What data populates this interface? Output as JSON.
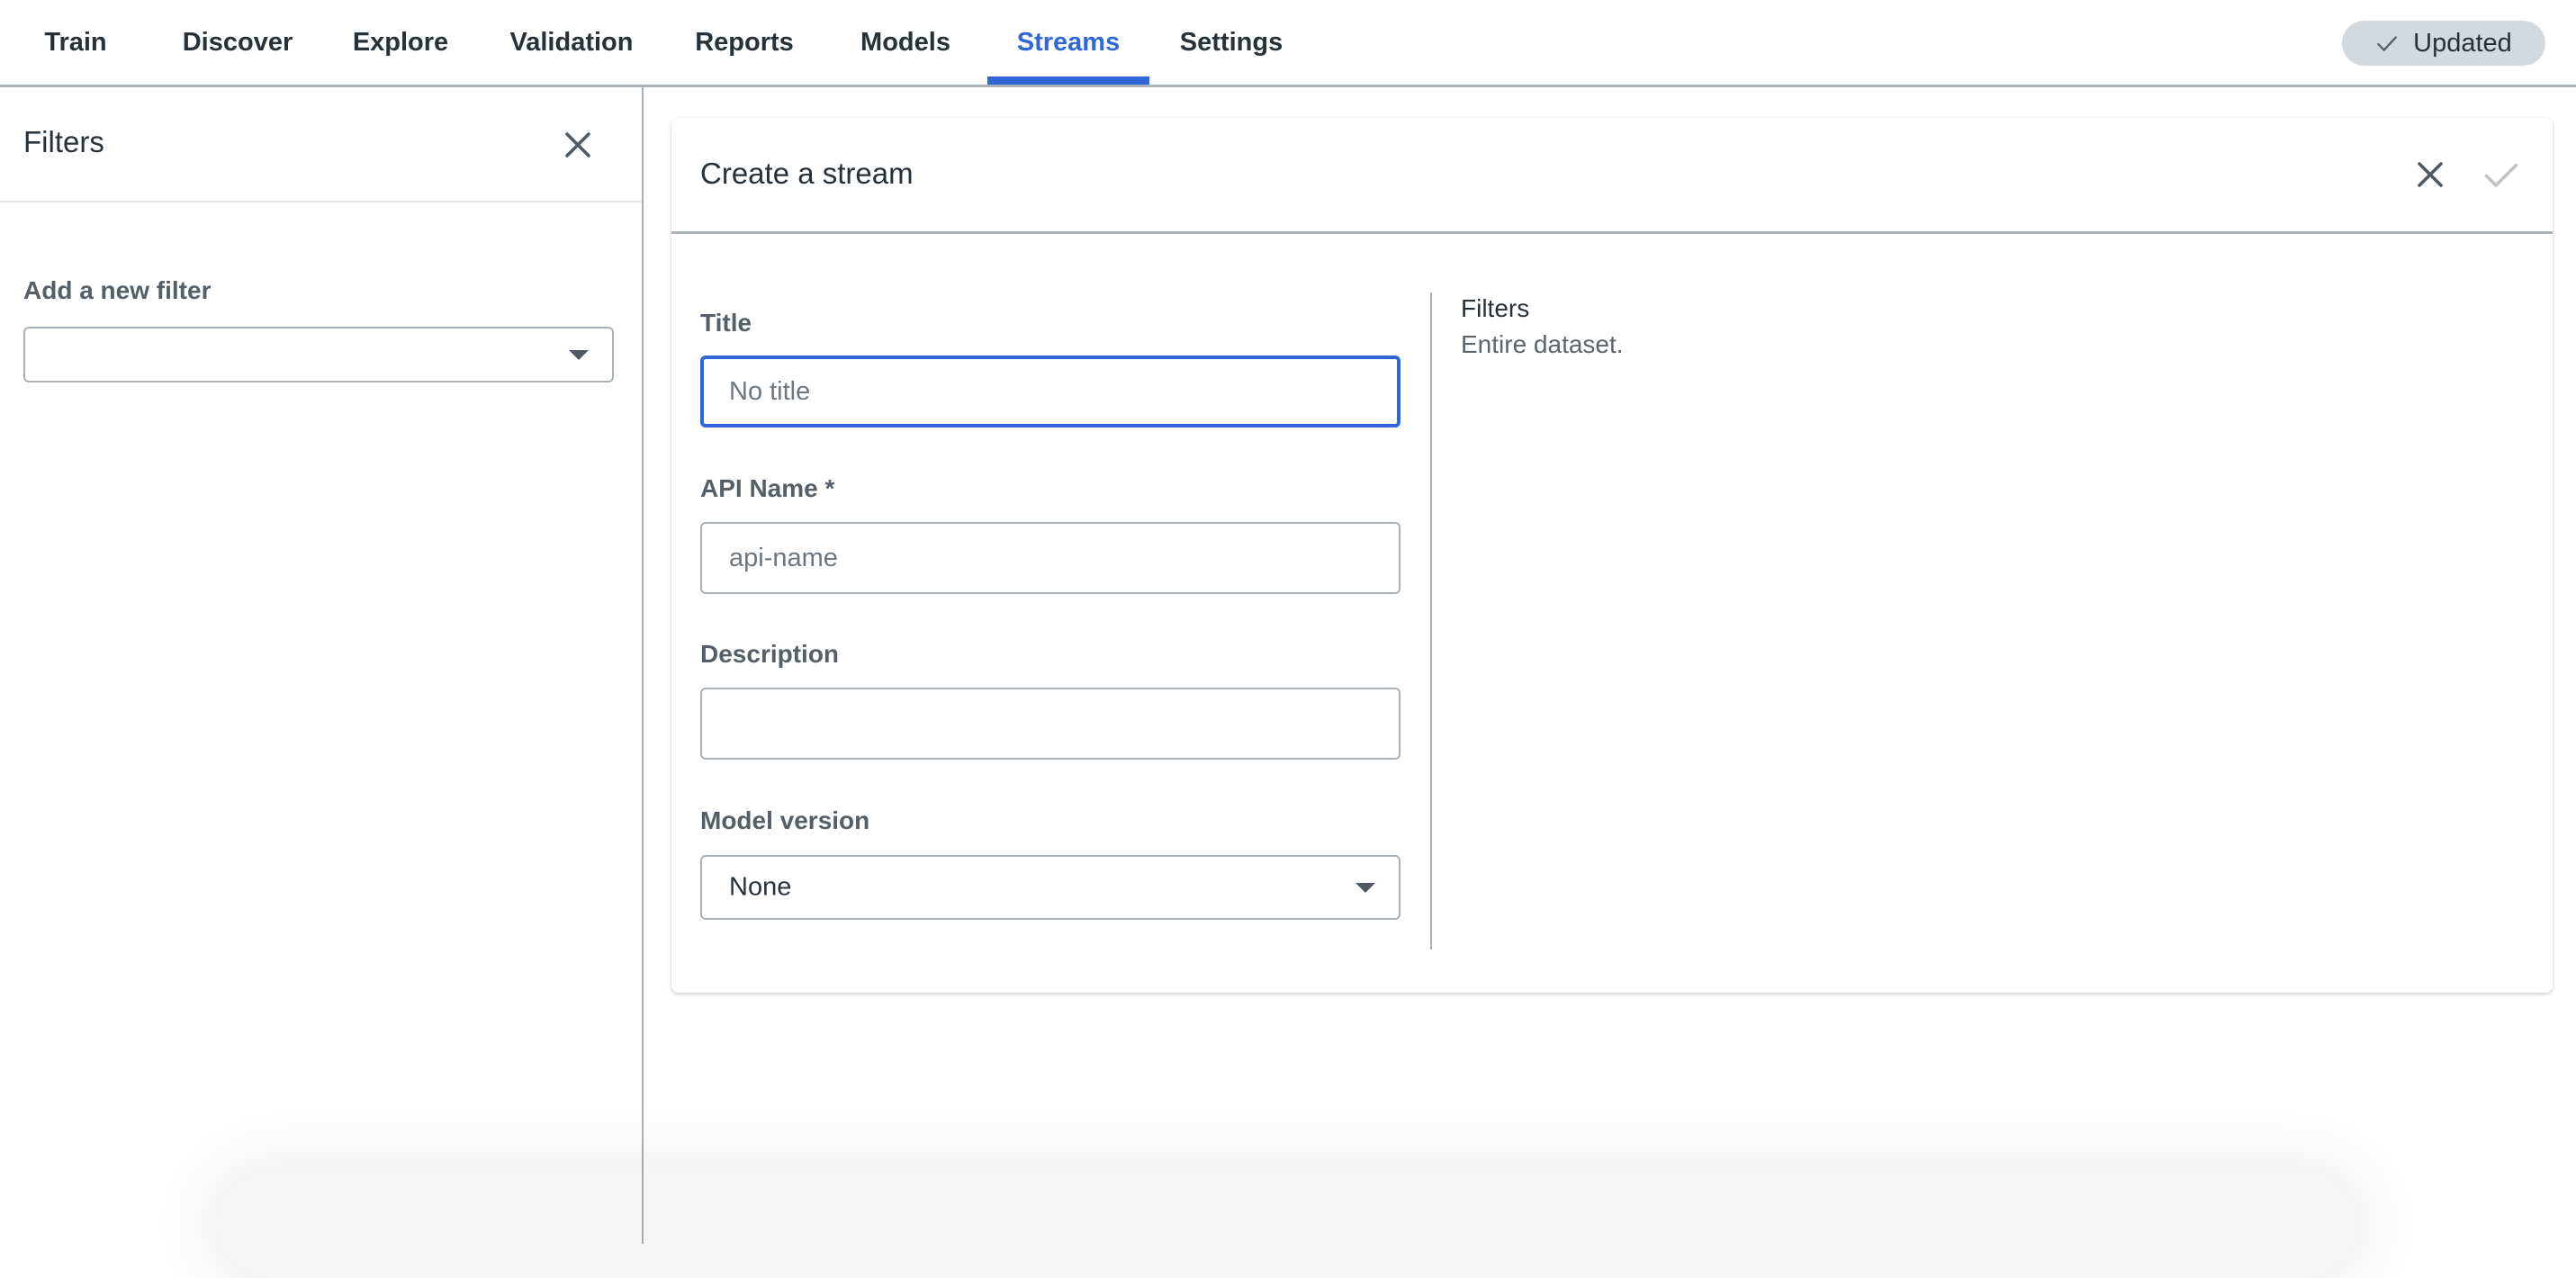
{
  "nav": {
    "tabs": [
      {
        "label": "Train",
        "active": false
      },
      {
        "label": "Discover",
        "active": false
      },
      {
        "label": "Explore",
        "active": false
      },
      {
        "label": "Validation",
        "active": false
      },
      {
        "label": "Reports",
        "active": false
      },
      {
        "label": "Models",
        "active": false
      },
      {
        "label": "Streams",
        "active": true
      },
      {
        "label": "Settings",
        "active": false
      }
    ],
    "status": {
      "label": "Updated",
      "icon": "check-icon"
    },
    "accent_color": "#2f68d6"
  },
  "sidebar": {
    "title": "Filters",
    "close_icon": "close-icon",
    "add_filter_label": "Add a new filter",
    "add_filter_value": ""
  },
  "create_stream": {
    "title": "Create a stream",
    "close_icon": "close-icon",
    "confirm_icon": "check-icon",
    "fields": {
      "title": {
        "label": "Title",
        "value": "",
        "placeholder": "No title"
      },
      "api_name": {
        "label": "API Name *",
        "value": "",
        "placeholder": "api-name"
      },
      "description": {
        "label": "Description",
        "value": "",
        "placeholder": ""
      },
      "model_version": {
        "label": "Model version",
        "value": "None"
      }
    },
    "summary": {
      "filters_title": "Filters",
      "filters_value": "Entire dataset."
    }
  }
}
